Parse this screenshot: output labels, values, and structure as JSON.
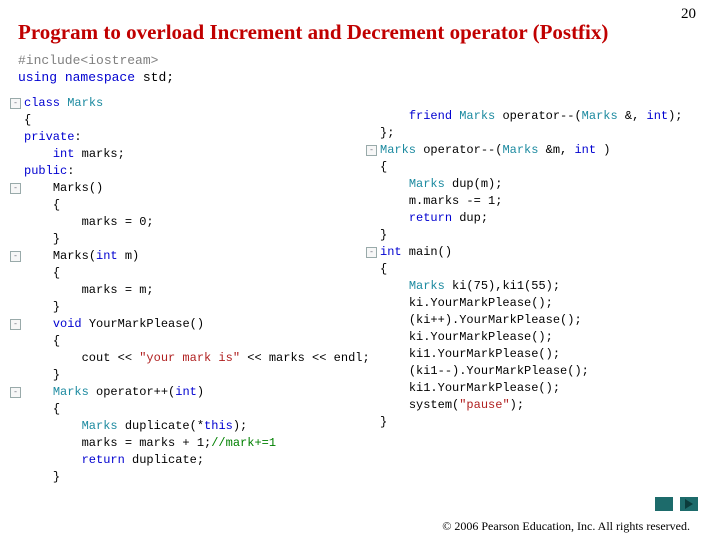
{
  "page_number": "20",
  "title": "Program to overload Increment and Decrement operator (Postfix)",
  "preamble": {
    "include_pp": "#include",
    "include_lt": "<",
    "include_io": "io",
    "include_stream": "stream>",
    "using_kw": "using",
    "namespace_kw": "namespace",
    "std_name": "std;"
  },
  "left": {
    "l1_kw": "class",
    "l1_name": "Marks",
    "l2": "{",
    "l3_kw": "private",
    "l3_colon": ":",
    "l4_kw": "int",
    "l4_rest": " marks;",
    "l5_kw": "public",
    "l5_colon": ":",
    "l6": "Marks()",
    "l7": "{",
    "l8": "marks = 0;",
    "l9": "}",
    "l10_ctor": "Marks(",
    "l10_kw": "int",
    "l10_rest": " m)",
    "l11": "{",
    "l12": "marks = m;",
    "l13": "}",
    "l14_kw": "void",
    "l14_rest": " YourMarkPlease()",
    "l15": "{",
    "l16_a": "cout << ",
    "l16_str": "\"your mark is\"",
    "l16_b": " << marks << endl;",
    "l17": "}",
    "l18_type": "Marks",
    "l18_rest": " operator++(",
    "l18_kw": "int",
    "l18_close": ")",
    "l19": "{",
    "l20_type": "Marks",
    "l20_rest": " duplicate(*",
    "l20_kw": "this",
    "l20_close": ");",
    "l21_a": "marks = marks + 1;",
    "l21_cmt": "//mark+=1",
    "l22_kw": "return",
    "l22_rest": " duplicate;",
    "l23": "}"
  },
  "right": {
    "r1_kw": "friend",
    "r1_type": " Marks",
    "r1_mid": " operator--(",
    "r1_type2": "Marks",
    "r1_rest": " &, ",
    "r1_int": "int",
    "r1_close": ");",
    "r2": "};",
    "r3_type": "Marks",
    "r3_mid": " operator--(",
    "r3_type2": "Marks",
    "r3_rest": " &m, ",
    "r3_int": "int",
    "r3_close": " )",
    "r4": "{",
    "r5_type": "Marks",
    "r5_rest": " dup(m);",
    "r6": "m.marks -= 1;",
    "r7_kw": "return",
    "r7_rest": " dup;",
    "r8": "}",
    "r9_kw": "int",
    "r9_rest": " main()",
    "r10": "{",
    "r11_type": "Marks",
    "r11_rest": " ki(75),ki1(55);",
    "r12": "ki.YourMarkPlease();",
    "r13": "(ki++).YourMarkPlease();",
    "r14": "ki.YourMarkPlease();",
    "r15": "ki1.YourMarkPlease();",
    "r16": "(ki1--).YourMarkPlease();",
    "r17": "ki1.YourMarkPlease();",
    "r18_a": "system(",
    "r18_str": "\"pause\"",
    "r18_b": ");",
    "r19": "}"
  },
  "copyright": "© 2006 Pearson Education, Inc.  All rights reserved."
}
